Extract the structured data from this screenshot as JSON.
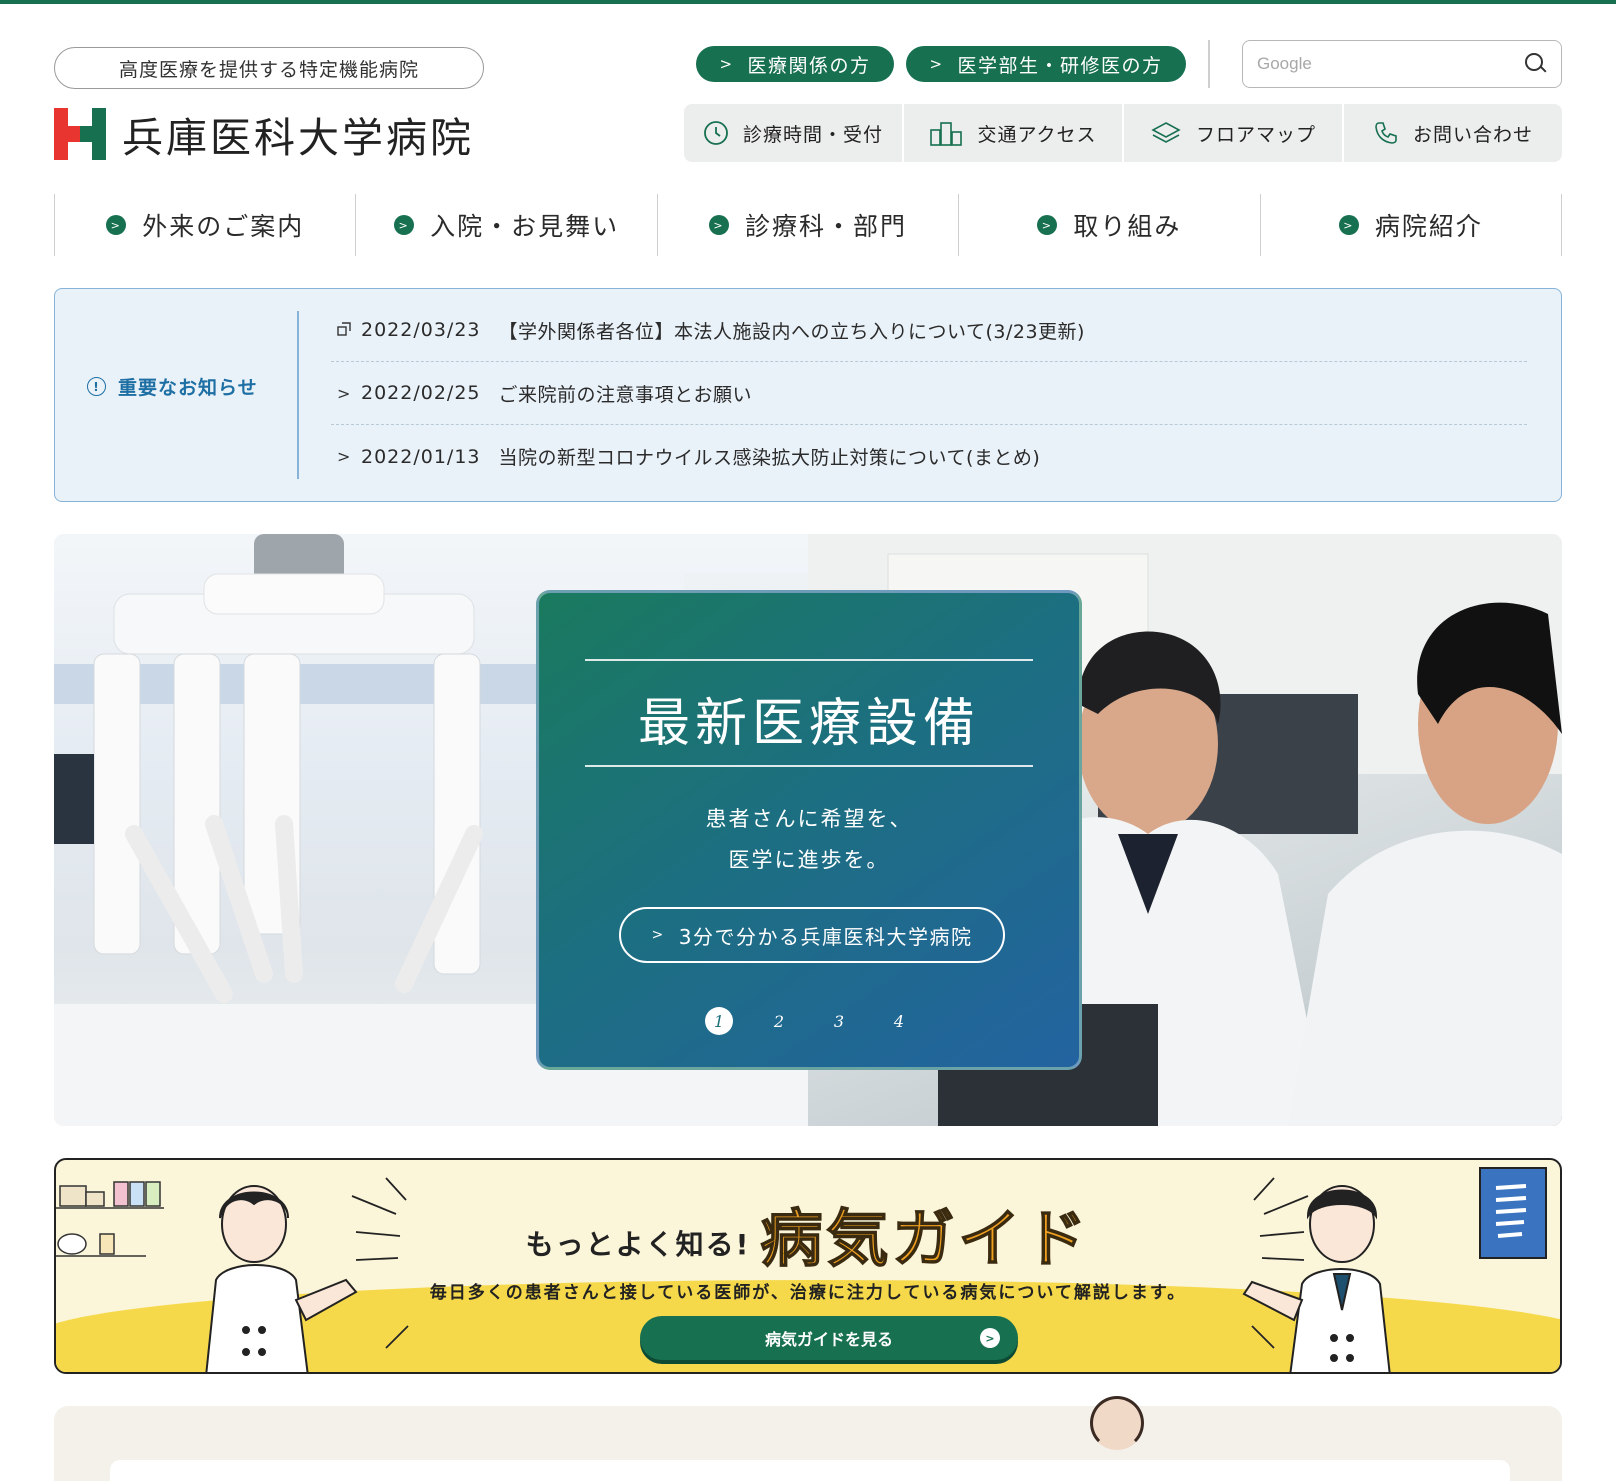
{
  "header": {
    "tagline": "高度医療を提供する特定機能病院",
    "hospital_name": "兵庫医科大学病院",
    "audience_links": [
      {
        "label": "医療関係の方"
      },
      {
        "label": "医学部生・研修医の方"
      }
    ],
    "search": {
      "placeholder": "Google",
      "value": ""
    },
    "utility_links": [
      {
        "label": "診療時間・受付",
        "icon": "clock-icon"
      },
      {
        "label": "交通アクセス",
        "icon": "buildings-icon"
      },
      {
        "label": "フロアマップ",
        "icon": "layers-icon"
      },
      {
        "label": "お問い合わせ",
        "icon": "phone-icon"
      }
    ]
  },
  "nav": {
    "items": [
      {
        "label": "外来のご案内"
      },
      {
        "label": "入院・お見舞い"
      },
      {
        "label": "診療科・部門"
      },
      {
        "label": "取り組み"
      },
      {
        "label": "病院紹介"
      }
    ]
  },
  "notices": {
    "heading": "重要なお知らせ",
    "items": [
      {
        "date": "2022/03/23",
        "title": "【学外関係者各位】本法人施設内への立ち入りについて(3/23更新)",
        "icon": "external-link-icon"
      },
      {
        "date": "2022/02/25",
        "title": "ご来院前の注意事項とお願い",
        "icon": "chevron-right-icon"
      },
      {
        "date": "2022/01/13",
        "title": "当院の新型コロナウイルス感染拡大防止対策について(まとめ)",
        "icon": "chevron-right-icon"
      }
    ]
  },
  "hero": {
    "title": "最新医療設備",
    "subtitle_line1": "患者さんに希望を、",
    "subtitle_line2": "医学に進歩を。",
    "button_label": "3分で分かる兵庫医科大学病院",
    "slides": [
      "1",
      "2",
      "3",
      "4"
    ],
    "active_slide": 1
  },
  "banner": {
    "lead": "もっとよく知る!",
    "title": "病気ガイド",
    "description": "毎日多くの患者さんと接している医師が、治療に注力している病気について解説します。",
    "button_label": "病気ガイドを見る"
  },
  "colors": {
    "brand_green": "#17704f",
    "brand_red": "#e8352f",
    "notice_blue": "#1e6fa3",
    "banner_yellow": "#f6d94b"
  }
}
